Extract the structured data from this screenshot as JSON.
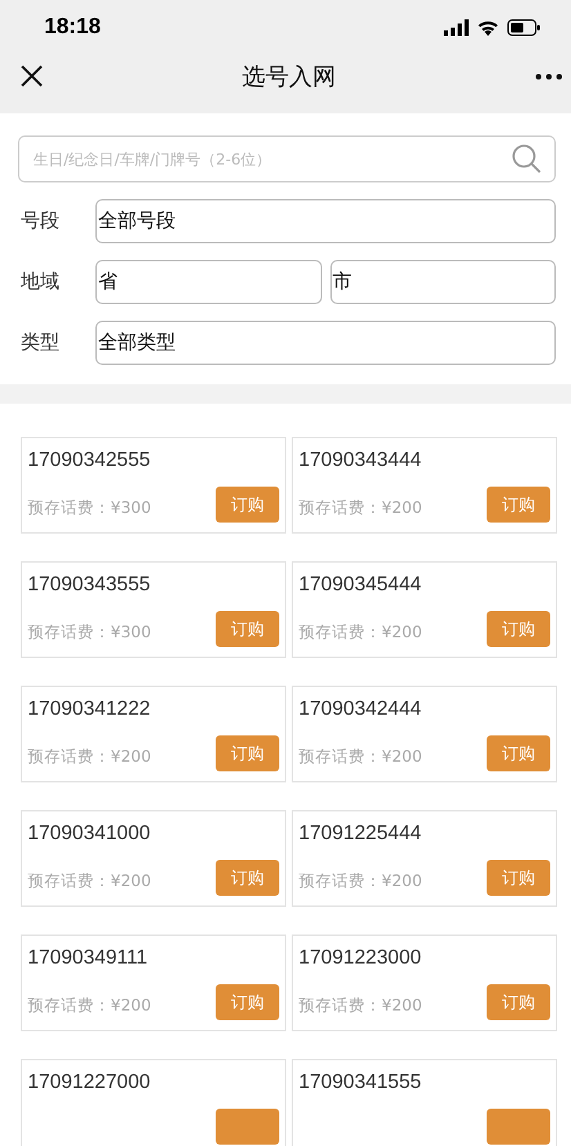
{
  "status_bar": {
    "time": "18:18"
  },
  "nav": {
    "title": "选号入网"
  },
  "search": {
    "placeholder": "生日/纪念日/车牌/门牌号（2-6位）"
  },
  "filters": [
    {
      "label": "号段",
      "fields": [
        "全部号段"
      ]
    },
    {
      "label": "地域",
      "fields": [
        "省",
        "市"
      ]
    },
    {
      "label": "类型",
      "fields": [
        "全部类型"
      ]
    }
  ],
  "numbers": [
    {
      "number": "17090342555",
      "fee": "预存话费：¥300",
      "button": "订购"
    },
    {
      "number": "17090343444",
      "fee": "预存话费：¥200",
      "button": "订购"
    },
    {
      "number": "17090343555",
      "fee": "预存话费：¥300",
      "button": "订购"
    },
    {
      "number": "17090345444",
      "fee": "预存话费：¥200",
      "button": "订购"
    },
    {
      "number": "17090341222",
      "fee": "预存话费：¥200",
      "button": "订购"
    },
    {
      "number": "17090342444",
      "fee": "预存话费：¥200",
      "button": "订购"
    },
    {
      "number": "17090341000",
      "fee": "预存话费：¥200",
      "button": "订购"
    },
    {
      "number": "17091225444",
      "fee": "预存话费：¥200",
      "button": "订购"
    },
    {
      "number": "17090349111",
      "fee": "预存话费：¥200",
      "button": "订购"
    },
    {
      "number": "17091223000",
      "fee": "预存话费：¥200",
      "button": "订购"
    },
    {
      "number": "17091227000"
    },
    {
      "number": "17090341555"
    }
  ]
}
